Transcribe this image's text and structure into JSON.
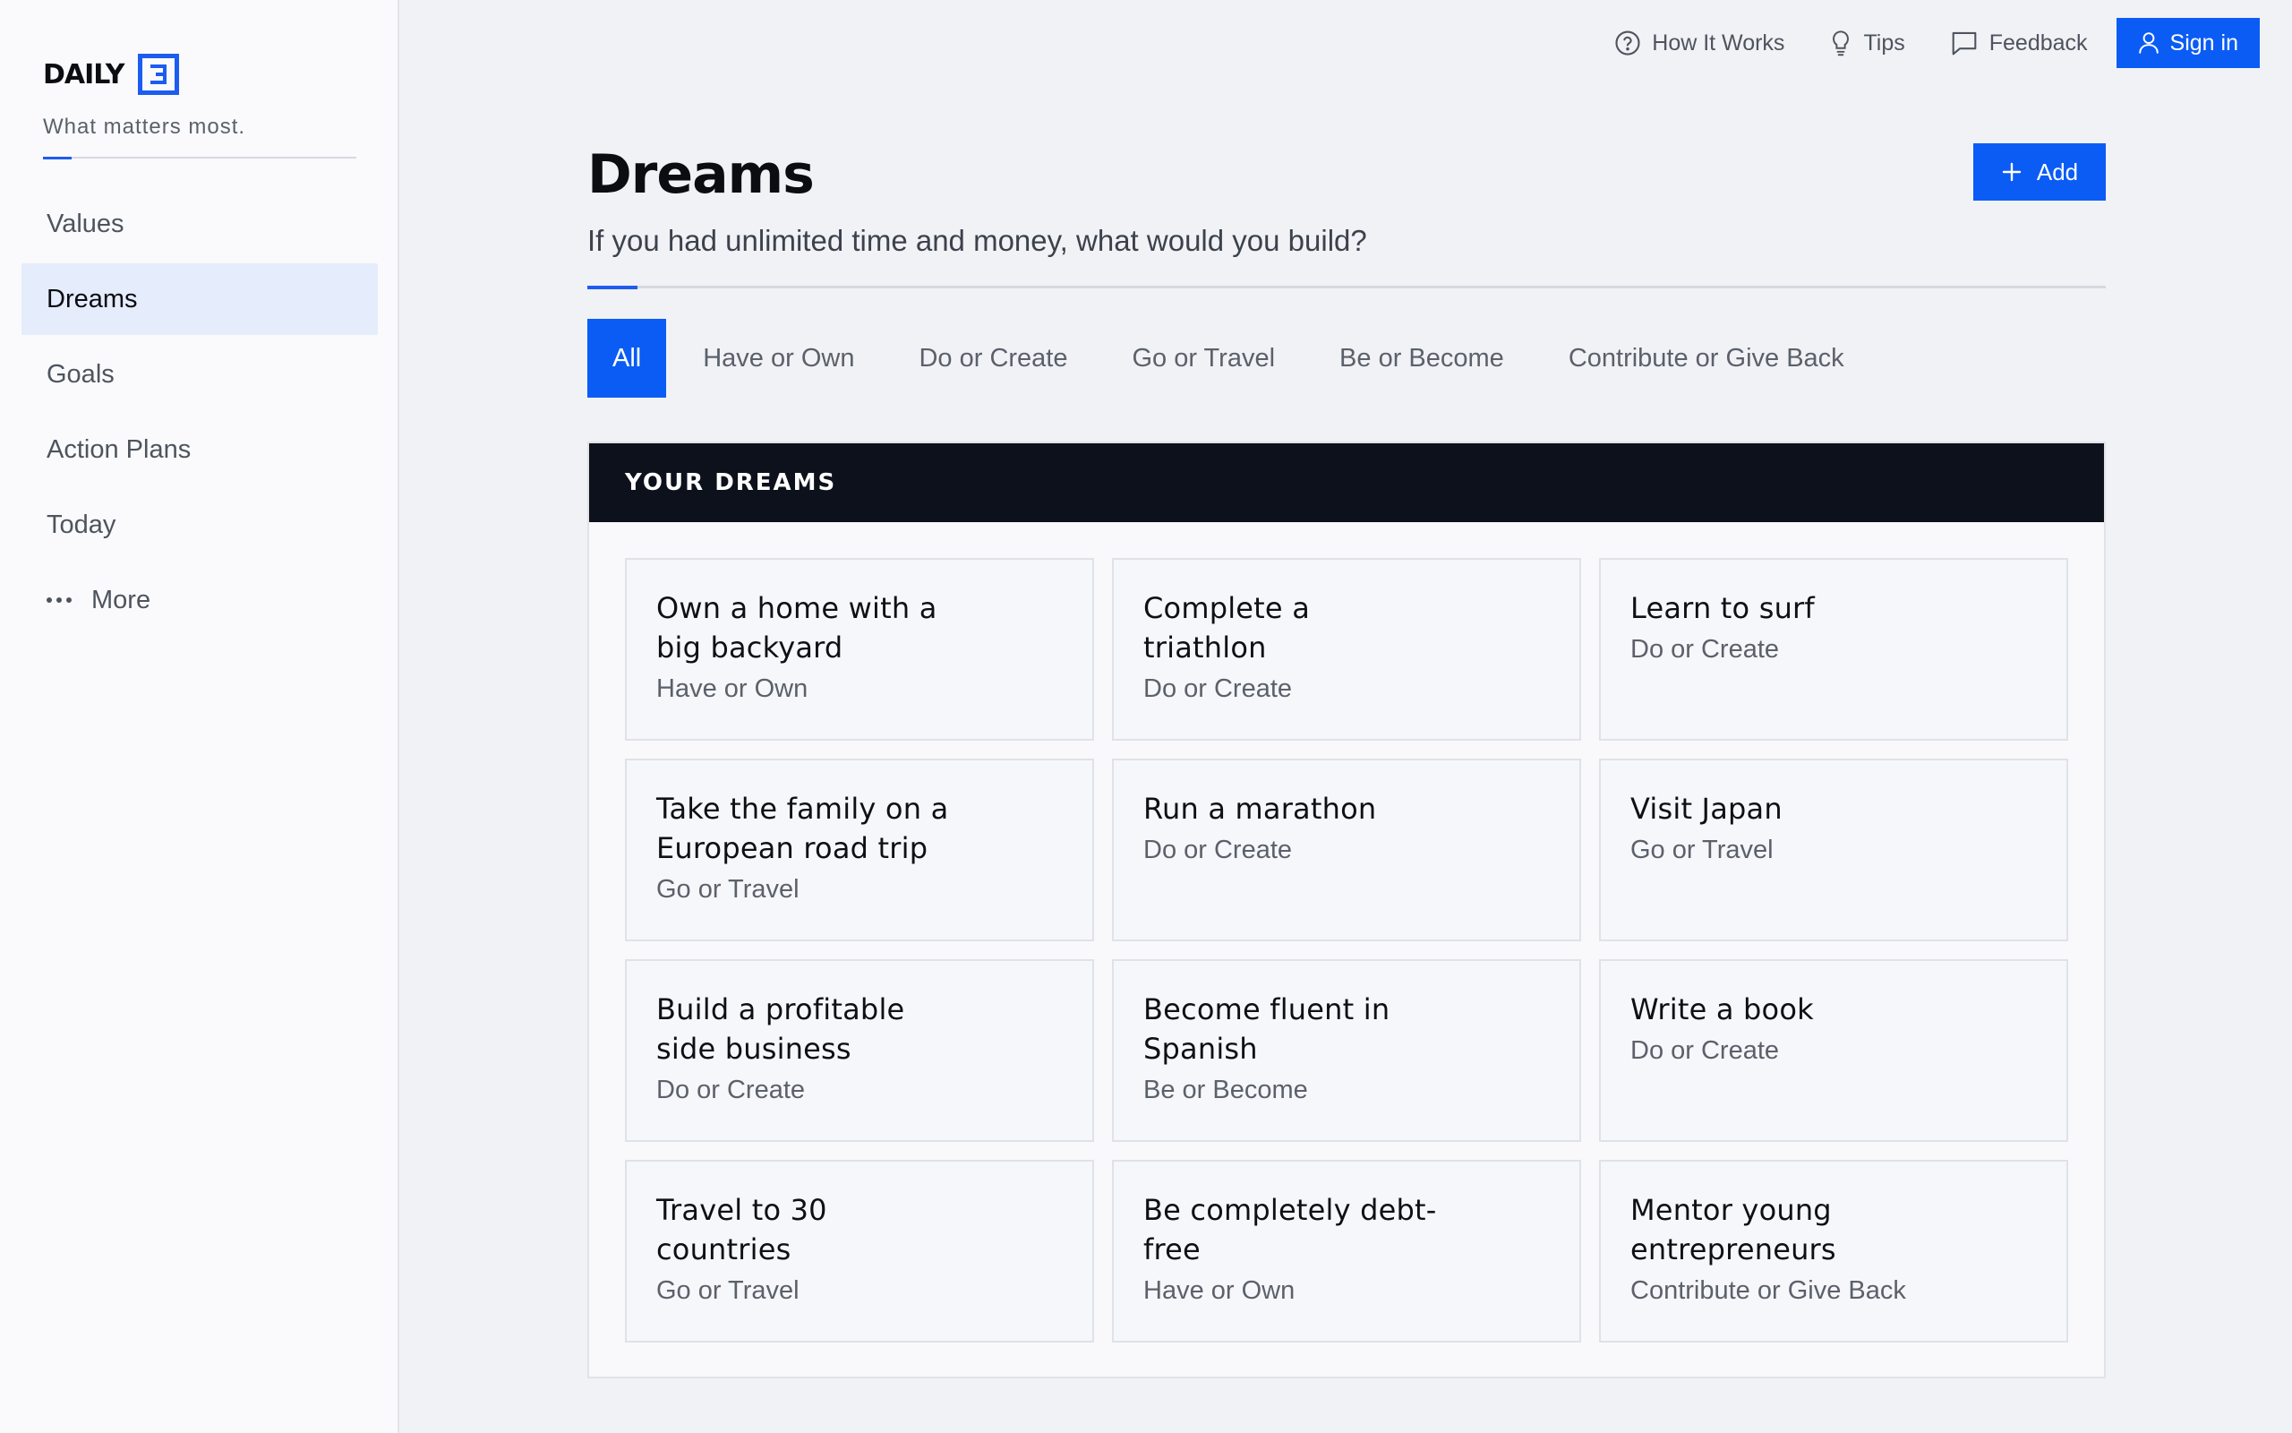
{
  "brand": {
    "name": "DAILY",
    "logo_icon": "e-box-logo",
    "tagline": "What matters most.",
    "accent_color": "#1d5cf0"
  },
  "sidebar": {
    "items": [
      {
        "label": "Values",
        "active": false
      },
      {
        "label": "Dreams",
        "active": true
      },
      {
        "label": "Goals",
        "active": false
      },
      {
        "label": "Action Plans",
        "active": false
      },
      {
        "label": "Today",
        "active": false
      },
      {
        "label": "More",
        "active": false,
        "icon": "more-dots-icon"
      }
    ]
  },
  "topbar": {
    "how_it_works": {
      "label": "How It Works",
      "icon": "help-circle-icon"
    },
    "tips": {
      "label": "Tips",
      "icon": "lightbulb-icon"
    },
    "feedback": {
      "label": "Feedback",
      "icon": "chat-bubble-icon"
    },
    "signin": {
      "label": "Sign in",
      "icon": "user-icon"
    }
  },
  "page": {
    "title": "Dreams",
    "subtitle": "If you had unlimited time and money, what would you build?",
    "add_label": "Add"
  },
  "tabs": [
    {
      "label": "All",
      "active": true
    },
    {
      "label": "Have or Own",
      "active": false
    },
    {
      "label": "Do or Create",
      "active": false
    },
    {
      "label": "Go or Travel",
      "active": false
    },
    {
      "label": "Be or Become",
      "active": false
    },
    {
      "label": "Contribute or Give Back",
      "active": false
    }
  ],
  "panel": {
    "header": "YOUR DREAMS",
    "cards": [
      {
        "title": "Own a home with a big backyard",
        "category": "Have or Own"
      },
      {
        "title": "Complete a triathlon",
        "category": "Do or Create"
      },
      {
        "title": "Learn to surf",
        "category": "Do or Create"
      },
      {
        "title": "Take the family on a European road trip",
        "category": "Go or Travel"
      },
      {
        "title": "Run a marathon",
        "category": "Do or Create"
      },
      {
        "title": "Visit Japan",
        "category": "Go or Travel"
      },
      {
        "title": "Build a profitable side business",
        "category": "Do or Create"
      },
      {
        "title": "Become fluent in Spanish",
        "category": "Be or Become"
      },
      {
        "title": "Write a book",
        "category": "Do or Create"
      },
      {
        "title": "Travel to 30 countries",
        "category": "Go or Travel"
      },
      {
        "title": "Be completely debt-free",
        "category": "Have or Own"
      },
      {
        "title": "Mentor young entrepreneurs",
        "category": "Contribute or Give Back"
      }
    ]
  },
  "colors": {
    "primary": "#0b5cf5",
    "panel_header_bg": "#0c111b",
    "active_nav_bg": "#e5ecfb"
  }
}
